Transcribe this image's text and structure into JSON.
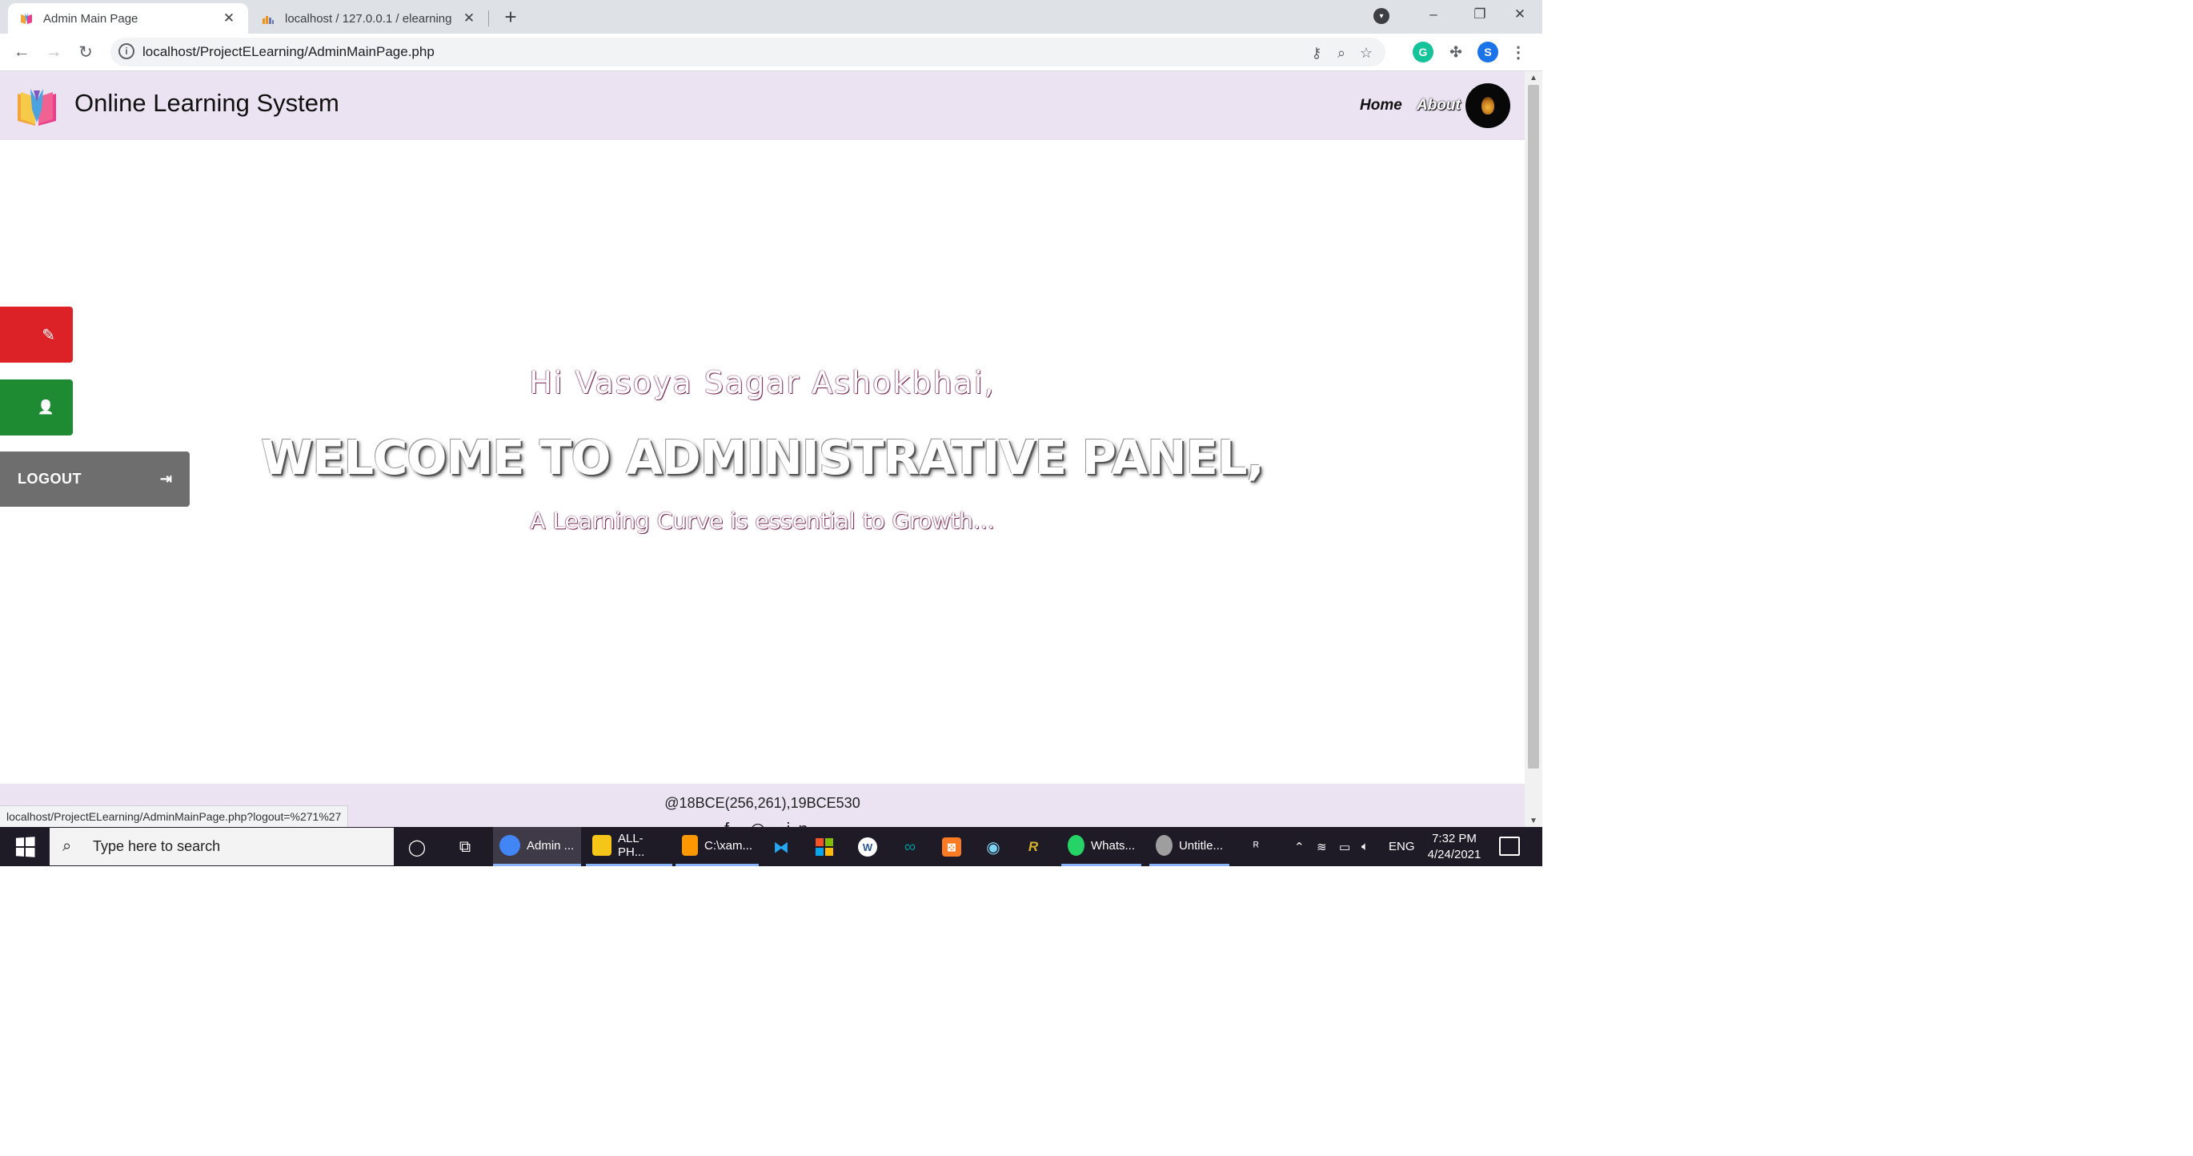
{
  "browser": {
    "tabs": [
      {
        "title": "Admin Main Page",
        "active": true
      },
      {
        "title": "localhost / 127.0.0.1 / elearning",
        "active": false
      }
    ],
    "new_tab": "+",
    "address": "localhost/ProjectELearning/AdminMainPage.php",
    "profile_initial": "S",
    "window_controls": {
      "minimize": "–",
      "restore": "❐",
      "close": "✕"
    }
  },
  "site": {
    "brand": "Online Learning System",
    "nav": {
      "home": "Home",
      "about": "About"
    }
  },
  "sidebar": {
    "edit_icon": "✎",
    "user_icon": "👤",
    "logout_label": "LOGOUT",
    "logout_icon": "⇥"
  },
  "hero": {
    "greeting": "Hi Vasoya Sagar Ashokbhai,",
    "headline": "WELCOME TO ADMINISTRATIVE PANEL,",
    "tagline": "A Learning Curve is essential to Growth..."
  },
  "footer": {
    "credits": "@18BCE(256,261),19BCE530",
    "social": "f ◎ in"
  },
  "status_bar": {
    "url": "localhost/ProjectELearning/AdminMainPage.php?logout=%271%27"
  },
  "taskbar": {
    "search_placeholder": "Type here to search",
    "apps": [
      {
        "label": "Admin ...",
        "icon": "chrome-icon",
        "color": "#4285f4"
      },
      {
        "label": "ALL-PH...",
        "icon": "folder-icon",
        "color": "#f5c518"
      },
      {
        "label": "C:\\xam...",
        "icon": "sublime-icon",
        "color": "#ff9800"
      },
      {
        "label": "Whats...",
        "icon": "whatsapp-icon",
        "color": "#25d366"
      },
      {
        "label": "Untitle...",
        "icon": "paint-icon",
        "color": "#9e9e9e"
      }
    ],
    "tray_lang": "ENG",
    "time": "7:32 PM",
    "date": "4/24/2021"
  },
  "colors": {
    "header_bg": "#ebe2f2",
    "edit_button": "#dc2227",
    "user_button": "#1e8a32",
    "logout_button": "#6e6e6e"
  }
}
